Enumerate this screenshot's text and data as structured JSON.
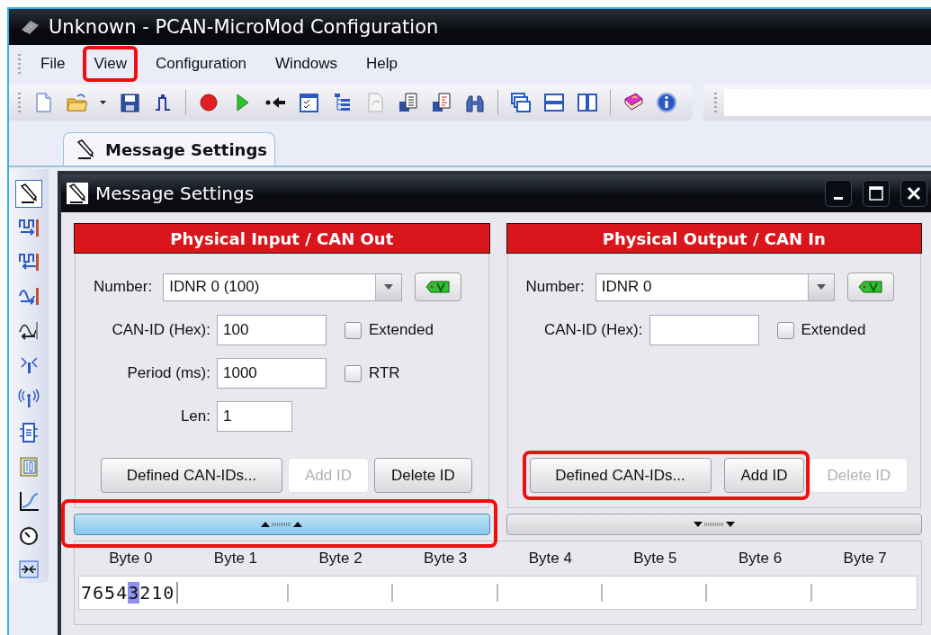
{
  "window": {
    "title": "Unknown - PCAN-MicroMod Configuration"
  },
  "menu": [
    {
      "label": "File",
      "highlighted": false
    },
    {
      "label": "View",
      "highlighted": true
    },
    {
      "label": "Configuration",
      "highlighted": false
    },
    {
      "label": "Windows",
      "highlighted": false
    },
    {
      "label": "Help",
      "highlighted": false
    }
  ],
  "tabs": [
    {
      "label": "Message Settings",
      "selected": true
    }
  ],
  "side_tools": [
    {
      "selected": true
    },
    {
      "selected": false
    },
    {
      "selected": false
    },
    {
      "selected": false
    },
    {
      "selected": false
    },
    {
      "selected": false
    },
    {
      "selected": false
    },
    {
      "selected": false
    },
    {
      "selected": false
    },
    {
      "selected": false
    },
    {
      "selected": false
    },
    {
      "selected": false
    }
  ],
  "child_window": {
    "title": "Message Settings"
  },
  "panels": [
    {
      "title": "Physical Input / CAN Out",
      "fields": [
        {
          "kind": "combo",
          "label": "Number:",
          "value": "IDNR 0 (100)"
        },
        {
          "kind": "text",
          "label": "CAN-ID (Hex):",
          "value": "100",
          "checkbox": {
            "label": "Extended",
            "checked": false
          }
        },
        {
          "kind": "text",
          "label": "Period (ms):",
          "value": "1000",
          "checkbox": {
            "label": "RTR",
            "checked": false
          }
        },
        {
          "kind": "short",
          "label": "Len:",
          "value": "1"
        }
      ],
      "buttons": [
        {
          "label": "Defined CAN-IDs...",
          "disabled": false,
          "highlighted": false
        },
        {
          "label": "Add ID",
          "disabled": true,
          "highlighted": false
        },
        {
          "label": "Delete ID",
          "disabled": false,
          "highlighted": false
        }
      ],
      "splitter": {
        "kind": "up",
        "active": true,
        "highlighted": true
      }
    },
    {
      "title": "Physical Output / CAN In",
      "fields": [
        {
          "kind": "combo",
          "label": "Number:",
          "value": "IDNR 0"
        },
        {
          "kind": "text",
          "label": "CAN-ID (Hex):",
          "checkbox": {
            "label": "Extended",
            "checked": false
          }
        }
      ],
      "buttons": [
        {
          "label": "Defined CAN-IDs...",
          "disabled": false,
          "highlighted": true
        },
        {
          "label": "Add ID",
          "disabled": false,
          "highlighted": true
        },
        {
          "label": "Delete ID",
          "disabled": true,
          "highlighted": false
        }
      ],
      "splitter": {
        "kind": "down",
        "active": false,
        "highlighted": false
      }
    }
  ],
  "bytes": {
    "headers": [
      "Byte 0",
      "Byte 1",
      "Byte 2",
      "Byte 3",
      "Byte 4",
      "Byte 5",
      "Byte 6",
      "Byte 7"
    ],
    "bits": [
      {
        "digit": "7",
        "selected": false
      },
      {
        "digit": "6",
        "selected": false
      },
      {
        "digit": "5",
        "selected": false
      },
      {
        "digit": "4",
        "selected": false
      },
      {
        "digit": "3",
        "selected": true
      },
      {
        "digit": "2",
        "selected": false
      },
      {
        "digit": "1",
        "selected": false
      },
      {
        "digit": "0",
        "selected": false
      }
    ]
  }
}
